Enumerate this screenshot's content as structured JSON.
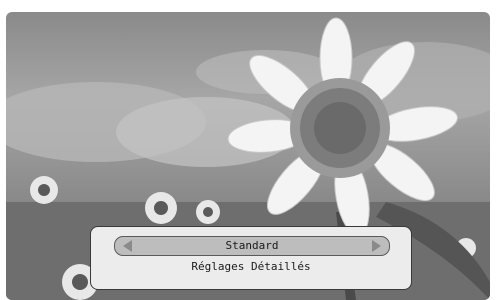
{
  "menu": {
    "selector_value": "Standard",
    "item_label": "Réglages Détaillés"
  },
  "icons": {
    "left": "triangle-left-icon",
    "right": "triangle-right-icon"
  }
}
